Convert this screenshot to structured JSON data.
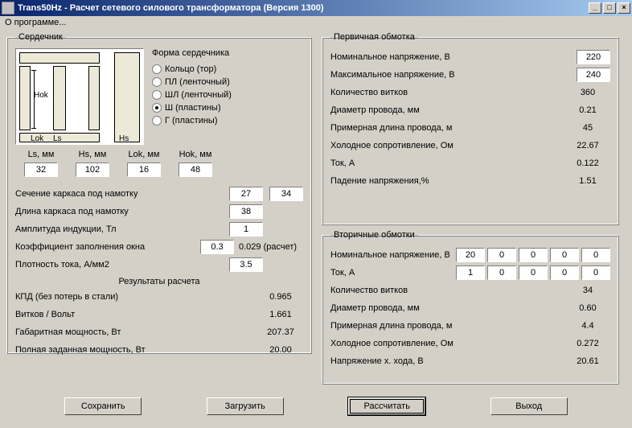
{
  "window": {
    "title": "Trans50Hz - Расчет сетевого силового трансформатора (Версия 1300)",
    "minimize": "_",
    "maximize": "□",
    "close": "×"
  },
  "menu": {
    "about": "О программе..."
  },
  "core": {
    "legend": "Сердечник",
    "form_label": "Форма сердечника",
    "options": {
      "ring": "Кольцо  (тор)",
      "pl": "ПЛ  (ленточный)",
      "shl": "ШЛ  (ленточный)",
      "sh": "Ш  (пластины)",
      "g": "Г  (пластины)"
    },
    "diag": {
      "hok": "Hok",
      "lok": "Lok",
      "ls": "Ls",
      "hs": "Hs"
    },
    "dims": {
      "ls_lbl": "Ls, мм",
      "hs_lbl": "Hs, мм",
      "lok_lbl": "Lok, мм",
      "hok_lbl": "Hok, мм",
      "ls": "32",
      "hs": "102",
      "lok": "16",
      "hok": "48"
    },
    "lines": {
      "frame_section": "Сечение каркаса под намотку",
      "frame_section_v1": "27",
      "frame_section_v2": "34",
      "frame_length": "Длина каркаса под намотку",
      "frame_length_v": "38",
      "induction": "Амплитуда индукции, Тл",
      "induction_v": "1",
      "fill": "Коэффициент заполнения окна",
      "fill_v": "0.3",
      "fill_calc": "0.029 (расчет)",
      "density": "Плотность тока, А/мм2",
      "density_v": "3.5"
    },
    "results": {
      "header": "Результаты расчета",
      "kpd": "КПД (без потерь в стали)",
      "kpd_v": "0.965",
      "vpv": "Витков / Вольт",
      "vpv_v": "1.661",
      "gab": "Габаритная мощность, Вт",
      "gab_v": "207.37",
      "full": "Полная заданная мощность, Вт",
      "full_v": "20.00"
    }
  },
  "primary": {
    "legend": "Первичная обмотка",
    "nom": "Номинальное напряжение, В",
    "nom_v": "220",
    "max": "Максимальное напряжение, В",
    "max_v": "240",
    "turns": "Количество витков",
    "turns_v": "360",
    "wire": "Диаметр провода, мм",
    "wire_v": "0.21",
    "len": "Примерная длина провода, м",
    "len_v": "45",
    "res": "Холодное сопротивление, Ом",
    "res_v": "22.67",
    "cur": "Ток, А",
    "cur_v": "0.122",
    "drop": "Падение напряжения,%",
    "drop_v": "1.51"
  },
  "secondary": {
    "legend": "Вторичные обмотки",
    "nom": "Номинальное напряжение, В",
    "nom_vals": [
      "20",
      "0",
      "0",
      "0",
      "0"
    ],
    "cur": "Ток, А",
    "cur_vals": [
      "1",
      "0",
      "0",
      "0",
      "0"
    ],
    "turns": "Количество витков",
    "turns_v": "34",
    "wire": "Диаметр провода, мм",
    "wire_v": "0.60",
    "len": "Примерная длина провода, м",
    "len_v": "4.4",
    "res": "Холодное сопротивление, Ом",
    "res_v": "0.272",
    "idle": "Напряжение х. хода, В",
    "idle_v": "20.61"
  },
  "buttons": {
    "save": "Сохранить",
    "load": "Загрузить",
    "calc": "Рассчитать",
    "exit": "Выход"
  }
}
